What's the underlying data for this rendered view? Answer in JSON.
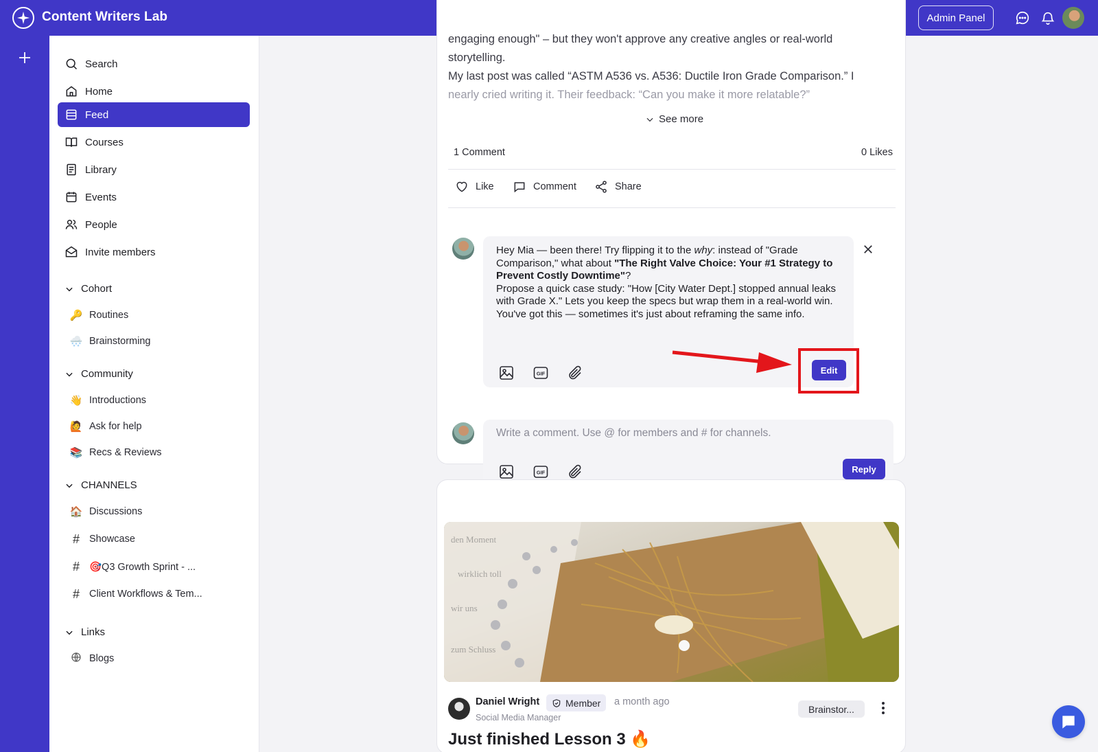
{
  "app": {
    "title": "Content Writers Lab",
    "admin_label": "Admin Panel"
  },
  "nav": {
    "search": "Search",
    "home": "Home",
    "feed": "Feed",
    "courses": "Courses",
    "library": "Library",
    "events": "Events",
    "people": "People",
    "invite": "Invite members"
  },
  "sections": {
    "cohort": {
      "title": "Cohort",
      "items": [
        {
          "emoji": "🔑",
          "label": "Routines"
        },
        {
          "emoji": "🌨️",
          "label": "Brainstorming"
        }
      ]
    },
    "community": {
      "title": "Community",
      "items": [
        {
          "emoji": "👋",
          "label": "Introductions"
        },
        {
          "emoji": "🙋",
          "label": "Ask for help"
        },
        {
          "emoji": "📚",
          "label": "Recs & Reviews"
        }
      ]
    },
    "channels": {
      "title": "CHANNELS",
      "items": [
        {
          "emoji": "🏠",
          "label": "Discussions"
        },
        {
          "emoji": "#",
          "label": "Showcase"
        },
        {
          "emoji": "#",
          "label": "🎯Q3 Growth Sprint - ..."
        },
        {
          "emoji": "#",
          "label": "Client Workflows & Tem..."
        }
      ]
    },
    "links": {
      "title": "Links",
      "items": [
        {
          "emoji": "🌐",
          "label": "Blogs"
        }
      ]
    }
  },
  "post": {
    "line1": "engaging enough\" – but they won't approve any creative angles or real-world",
    "line2": "storytelling.",
    "line3": "My last post was called “ASTM A536 vs. A536: Ductile Iron Grade Comparison.” I",
    "line4": "nearly cried writing it. Their feedback: “Can you make it more relatable?”",
    "see_more": "See more",
    "comments_count": "1 Comment",
    "likes_count": "0 Likes",
    "actions": {
      "like": "Like",
      "comment": "Comment",
      "share": "Share"
    }
  },
  "comment_edit": {
    "p1_pre": "Hey Mia — been there! Try flipping it to the ",
    "p1_em": "why",
    "p1_post": ": instead of \"Grade Comparison,\" what about ",
    "p1_bold": "\"The Right Valve Choice: Your #1 Strategy to Prevent Costly Downtime\"",
    "p1_end": "?",
    "p2": "Propose a quick case study: \"How [City Water Dept.] stopped annual leaks with Grade X.\" Lets you keep the specs but wrap them in a real-world win.",
    "p3": "You've got this — sometimes it's just about reframing the same info.",
    "edit_label": "Edit"
  },
  "reply": {
    "placeholder": "Write a comment. Use @ for members and # for channels.",
    "reply_label": "Reply"
  },
  "next_post": {
    "author": "Daniel Wright",
    "badge": "Member",
    "time": "a month ago",
    "role": "Social Media Manager",
    "channel": "Brainstor...",
    "title": "Just finished Lesson 3 🔥"
  },
  "colors": {
    "brand": "#4037c7",
    "highlight": "#e3161b",
    "fab": "#3a5be0"
  }
}
